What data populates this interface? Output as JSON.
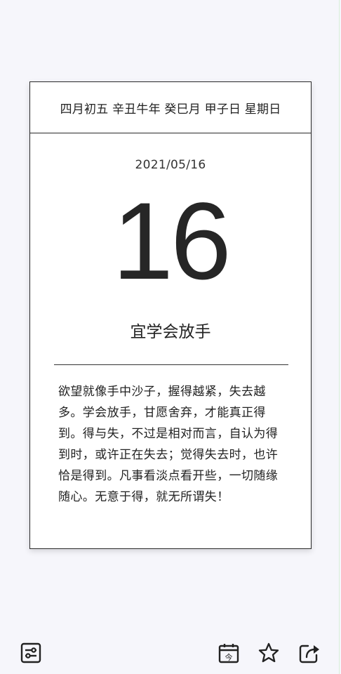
{
  "calendar": {
    "lunar_header": "四月初五 辛丑牛年 癸巳月 甲子日 星期日",
    "date": "2021/05/16",
    "day": "16",
    "advice": "宜学会放手",
    "quote": "欲望就像手中沙子，握得越紧，失去越多。学会放手，甘愿舍弃，才能真正得到。得与失，不过是相对而言，自认为得到时，或许正在失去；觉得失去时，也许恰是得到。凡事看淡点看开些，一切随缘随心。无意于得，就无所谓失！"
  },
  "toolbar": {
    "left": [
      {
        "icon": "settings-sliders-icon"
      }
    ],
    "right": [
      {
        "icon": "calendar-today-icon",
        "glyph": "今"
      },
      {
        "icon": "star-icon"
      },
      {
        "icon": "share-icon"
      }
    ]
  },
  "colors": {
    "background": "#f6f6fb",
    "card": "#ffffff",
    "ink": "#222222"
  }
}
